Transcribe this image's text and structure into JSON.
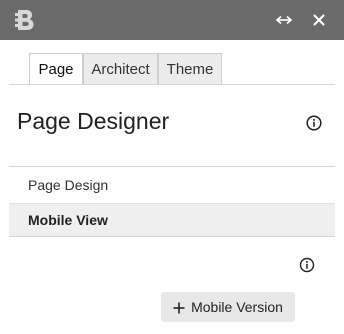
{
  "window": {
    "logo_icon": "b-logo-icon",
    "expand_icon": "horizontal-resize-arrows-icon",
    "close_icon": "close-icon",
    "titlebar_color": "#6b6b6b"
  },
  "tabs": [
    {
      "label": "Page",
      "active": true
    },
    {
      "label": "Architect",
      "active": false
    },
    {
      "label": "Theme",
      "active": false
    }
  ],
  "panel": {
    "title": "Page Designer",
    "info_icon": "info-icon"
  },
  "nav": {
    "items": [
      {
        "label": "Page Design",
        "selected": false
      },
      {
        "label": "Mobile View",
        "selected": true
      }
    ]
  },
  "mobile": {
    "info_icon": "info-icon",
    "add_button_label": "Mobile Version",
    "add_button_icon": "plus-icon"
  }
}
